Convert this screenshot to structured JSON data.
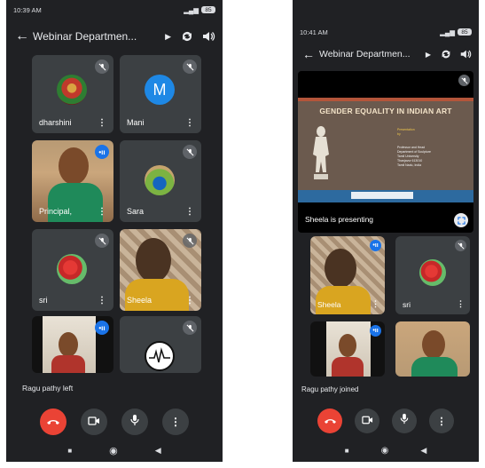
{
  "left": {
    "status": {
      "time": "10:39 AM",
      "battery": "85"
    },
    "meeting_title": "Webinar Departmen...",
    "tiles": [
      {
        "name": "dharshini"
      },
      {
        "name": "Mani",
        "initial": "M"
      },
      {
        "name": "Principal,"
      },
      {
        "name": "Sara"
      },
      {
        "name": "sri"
      },
      {
        "name": "Sheela"
      }
    ],
    "notice": "Ragu pathy left"
  },
  "right": {
    "status": {
      "time": "10:41 AM",
      "battery": "85"
    },
    "meeting_title": "Webinar Departmen...",
    "slide": {
      "title": "GENDER EQUALITY IN INDIAN ART",
      "presentation_by": "Presentation",
      "by": "by",
      "lines": [
        "Professor and Head",
        "Department of Sculpture",
        "Tamil University",
        "Thanjavur 613010",
        "Tamil Nadu, India"
      ]
    },
    "presenting_label": "Sheela is presenting",
    "tiles": [
      {
        "name": "Sheela"
      },
      {
        "name": "sri"
      }
    ],
    "notice": "Ragu pathy joined"
  },
  "colors": {
    "background": "#202124",
    "tile": "#3c4043",
    "end_call": "#ea4335",
    "accent": "#1a73e8"
  },
  "icons": [
    "back-arrow-icon",
    "caret-right-icon",
    "switch-camera-icon",
    "speaker-icon",
    "mic-off-icon",
    "more-vert-icon",
    "end-call-icon",
    "camera-icon",
    "mic-icon",
    "nav-home-icon",
    "nav-back-icon",
    "nav-recents-icon",
    "fullscreen-icon"
  ]
}
